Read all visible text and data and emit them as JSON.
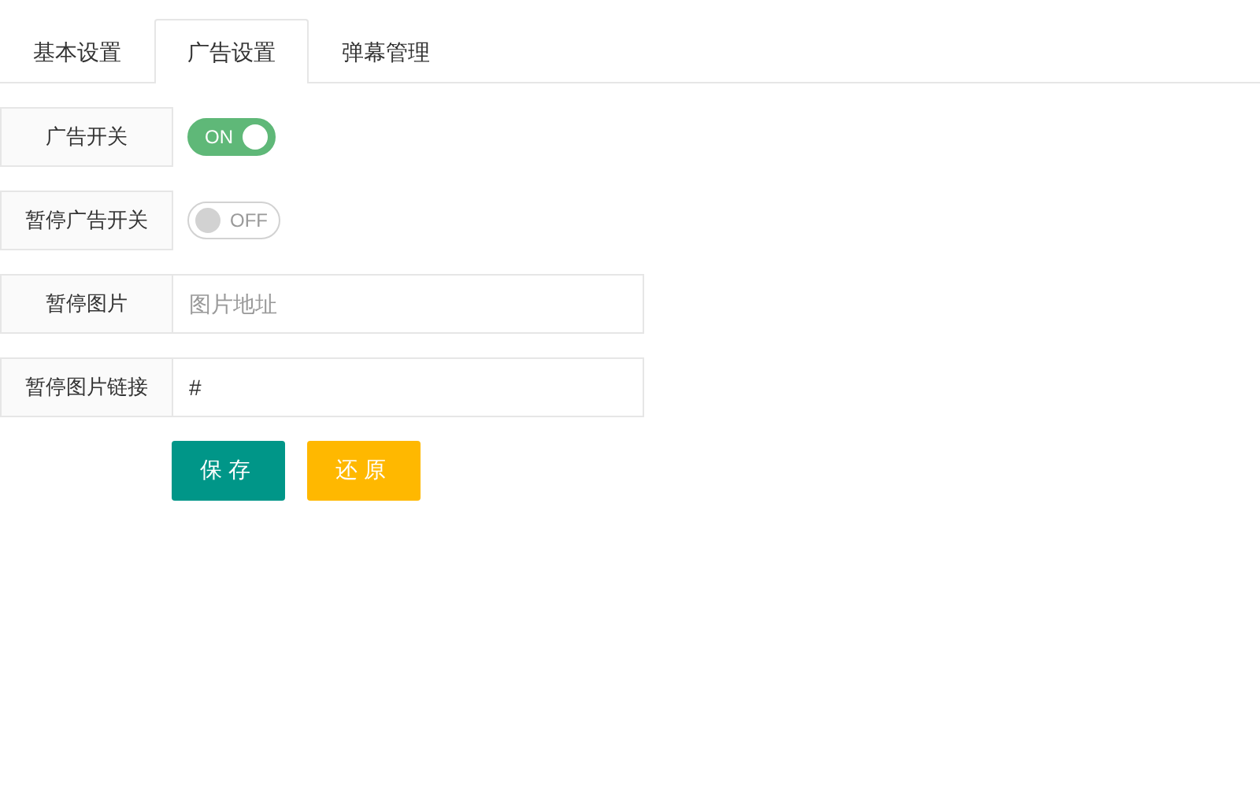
{
  "tabs": [
    {
      "label": "基本设置",
      "selected": false
    },
    {
      "label": "广告设置",
      "selected": true
    },
    {
      "label": "弹幕管理",
      "selected": false
    }
  ],
  "form": {
    "rows": [
      {
        "kind": "switch",
        "label": "广告开关",
        "on": true,
        "text": "ON"
      },
      {
        "kind": "switch",
        "label": "暂停广告开关",
        "on": false,
        "text": "OFF"
      },
      {
        "kind": "input",
        "label": "暂停图片",
        "placeholder": "图片地址"
      },
      {
        "kind": "input",
        "label": "暂停图片链接",
        "value": "#"
      }
    ],
    "buttons": [
      {
        "label": "保存",
        "kind": "primary"
      },
      {
        "label": "还原",
        "kind": "warm"
      }
    ]
  }
}
